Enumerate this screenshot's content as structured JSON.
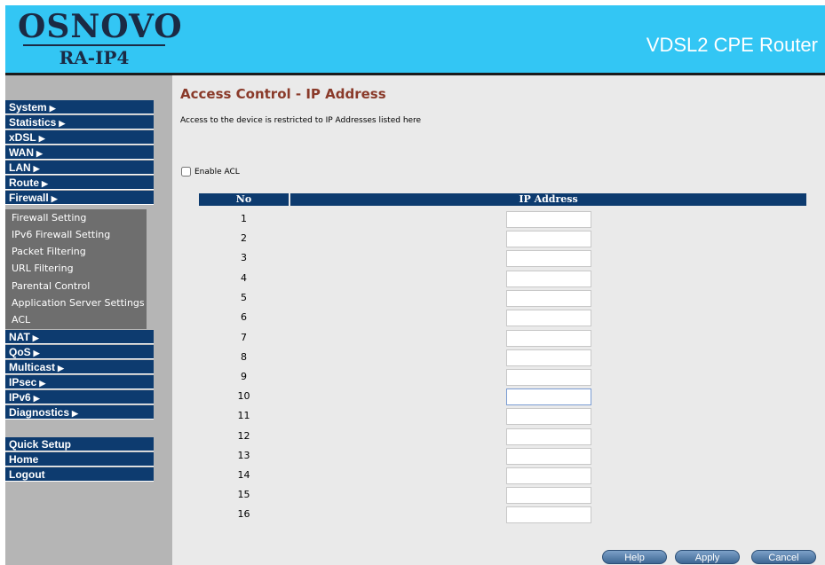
{
  "header": {
    "brand": "OSNOVO",
    "model": "RA-IP4",
    "product": "VDSL2 CPE Router"
  },
  "colors": {
    "header_bg": "#33c6f4",
    "menu_bg": "#0d3b6f",
    "submenu_bg": "#6e6e6e",
    "sidebar_bg": "#b5b5b5",
    "content_bg": "#eaeaea",
    "title_color": "#8a3a2a"
  },
  "sidebar": {
    "menu": [
      {
        "label": "System",
        "arrow": "▶"
      },
      {
        "label": "Statistics",
        "arrow": "▶"
      },
      {
        "label": "xDSL",
        "arrow": "▶"
      },
      {
        "label": "WAN",
        "arrow": "▶"
      },
      {
        "label": "LAN",
        "arrow": "▶"
      },
      {
        "label": "Route",
        "arrow": "▶"
      },
      {
        "label": "Firewall",
        "arrow": "▶"
      }
    ],
    "firewall_sub": [
      "Firewall Setting",
      "IPv6 Firewall Setting",
      "Packet Filtering",
      "URL Filtering",
      "Parental Control",
      "Application Server Settings",
      "ACL"
    ],
    "menu2": [
      {
        "label": "NAT",
        "arrow": "▶"
      },
      {
        "label": "QoS",
        "arrow": "▶"
      },
      {
        "label": "Multicast",
        "arrow": "▶"
      },
      {
        "label": "IPsec",
        "arrow": "▶"
      },
      {
        "label": "IPv6",
        "arrow": "▶"
      },
      {
        "label": "Diagnostics",
        "arrow": "▶"
      }
    ],
    "bottom": [
      "Quick Setup",
      "Home",
      "Logout"
    ]
  },
  "main": {
    "title": "Access Control - IP Address",
    "description": "Access to the device is restricted to IP Addresses listed here",
    "enable_acl_label": "Enable ACL",
    "enable_acl_checked": false,
    "table": {
      "headers": [
        "No",
        "IP Address"
      ],
      "rows": [
        {
          "no": "1",
          "ip": ""
        },
        {
          "no": "2",
          "ip": ""
        },
        {
          "no": "3",
          "ip": ""
        },
        {
          "no": "4",
          "ip": ""
        },
        {
          "no": "5",
          "ip": ""
        },
        {
          "no": "6",
          "ip": ""
        },
        {
          "no": "7",
          "ip": ""
        },
        {
          "no": "8",
          "ip": ""
        },
        {
          "no": "9",
          "ip": ""
        },
        {
          "no": "10",
          "ip": ""
        },
        {
          "no": "11",
          "ip": ""
        },
        {
          "no": "12",
          "ip": ""
        },
        {
          "no": "13",
          "ip": ""
        },
        {
          "no": "14",
          "ip": ""
        },
        {
          "no": "15",
          "ip": ""
        },
        {
          "no": "16",
          "ip": ""
        }
      ]
    },
    "buttons": {
      "help": "Help",
      "apply": "Apply",
      "cancel": "Cancel"
    }
  }
}
